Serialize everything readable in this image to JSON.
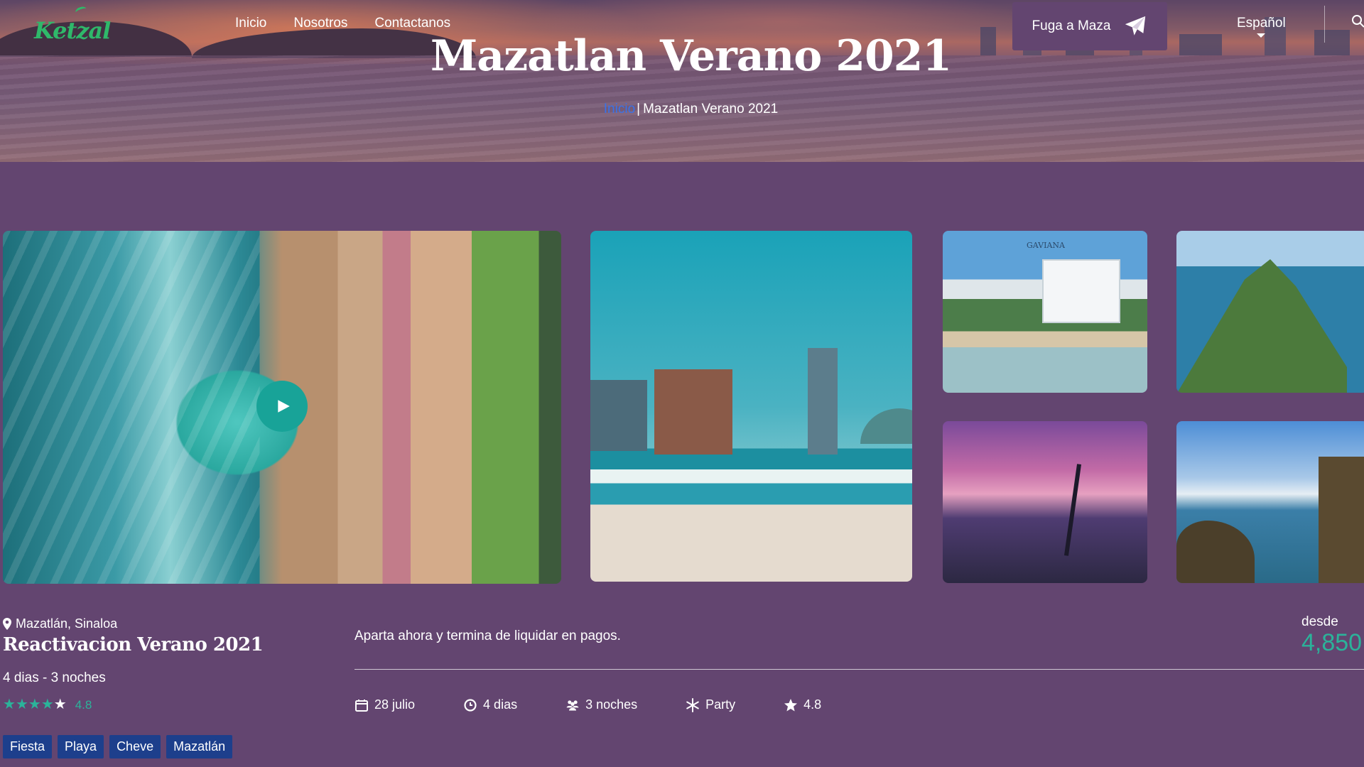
{
  "brand": {
    "logo_text": "Ketzal"
  },
  "nav": {
    "links": [
      "Inicio",
      "Nosotros",
      "Contactanos"
    ],
    "cta_label": "Fuga a Maza",
    "language": "Español"
  },
  "hero": {
    "title": "Mazatlan Verano 2021",
    "breadcrumb": {
      "home": "Inicio",
      "separator": "|",
      "current": "Mazatlan Verano 2021"
    }
  },
  "gallery": {
    "photo3_caption": "GAVIANA"
  },
  "tour": {
    "location": "Mazatlán, Sinaloa",
    "title": "Reactivacion Verano 2021",
    "duration": "4 dias - 3 noches",
    "rating": {
      "value": "4.8",
      "filled_stars": 4,
      "total_stars": 5
    },
    "tags": [
      "Fiesta",
      "Playa",
      "Cheve",
      "Mazatlán"
    ],
    "description": "Aparta ahora y termina de liquidar en pagos.",
    "features": [
      {
        "icon": "calendar-icon",
        "label": "28 julio"
      },
      {
        "icon": "clock-icon",
        "label": "4 dias"
      },
      {
        "icon": "group-icon",
        "label": "3 noches"
      },
      {
        "icon": "snowflake-icon",
        "label": "Party"
      },
      {
        "icon": "star-icon",
        "label": "4.8"
      }
    ],
    "price_label": "desde",
    "price": "4,850"
  },
  "colors": {
    "background": "#634570",
    "accent": "#2bb39a",
    "tag_bg": "#1d3f8c",
    "link": "#3a72e8",
    "logo": "#2fb86a"
  }
}
